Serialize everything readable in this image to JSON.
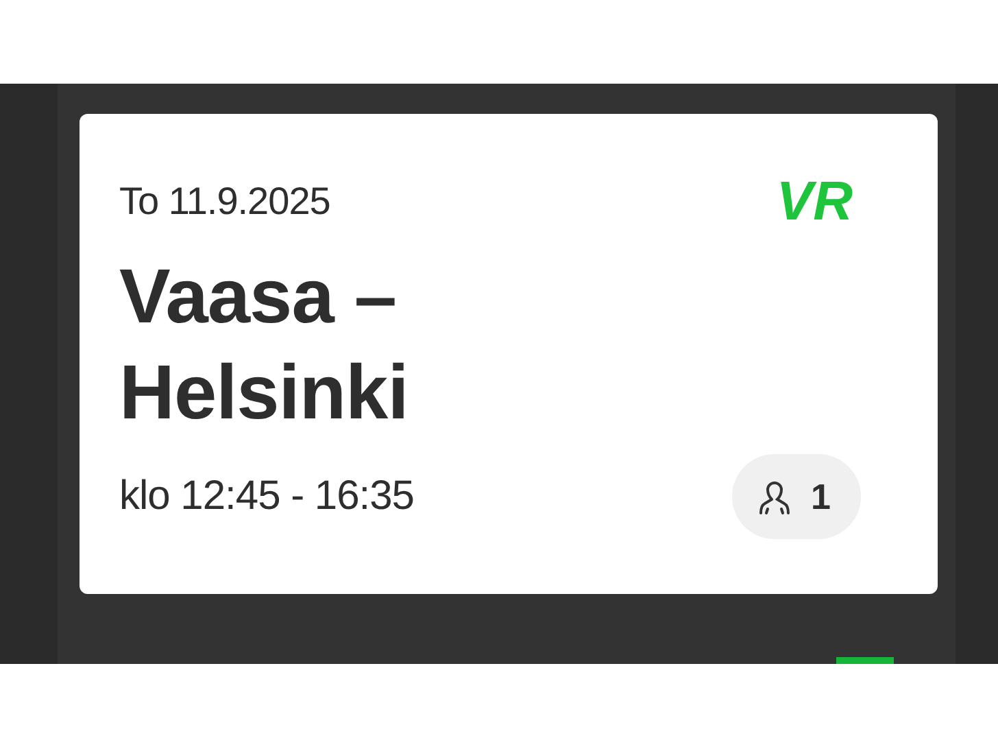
{
  "ticket": {
    "date": "To 11.9.2025",
    "logo": "VR",
    "route": [
      "Vaasa –",
      "Helsinki"
    ],
    "time": "klo 12:45 - 16:35",
    "passengers": "1"
  }
}
